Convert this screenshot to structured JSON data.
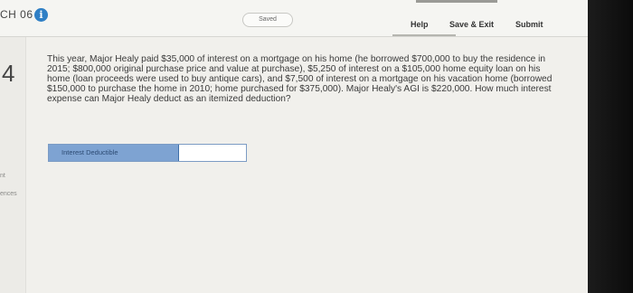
{
  "header": {
    "chapter": "CH 06",
    "saved_status": "Saved",
    "help": "Help",
    "save_exit": "Save & Exit",
    "submit": "Submit"
  },
  "sidebar": {
    "question_number": "4",
    "label_1": "nt",
    "label_2": "ences"
  },
  "question": {
    "text": "This year, Major Healy paid $35,000 of interest on a mortgage on his home (he borrowed $700,000 to buy the residence in 2015; $800,000 original purchase price and value at purchase), $5,250 of interest on a $105,000 home equity loan on his home (loan proceeds were used to buy antique cars), and $7,500 of interest on a mortgage on his vacation home (borrowed $150,000 to purchase the home in 2010; home purchased for $375,000). Major Healy's AGI is $220,000. How much interest expense can Major Healy deduct as an itemized deduction?"
  },
  "answer": {
    "label": "Interest Deductible",
    "value": ""
  },
  "colors": {
    "accent": "#2f7fc5",
    "answer_label_bg": "#7ea3d2"
  }
}
